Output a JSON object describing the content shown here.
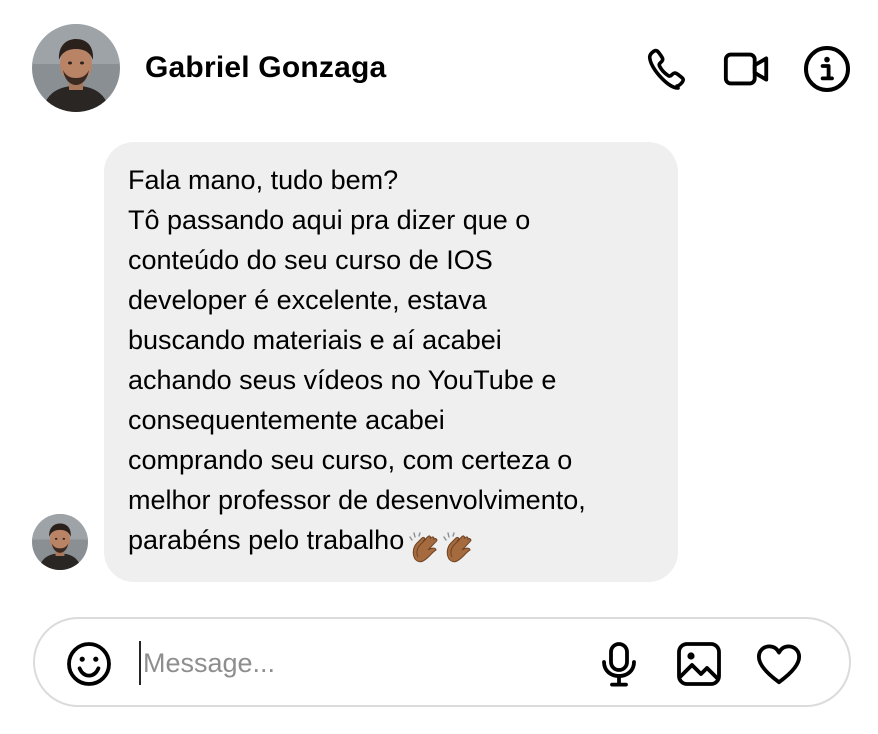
{
  "header": {
    "contact_name": "Gabriel Gonzaga",
    "avatar_icon": "profile-photo",
    "actions": [
      {
        "name": "phone-call",
        "icon": "phone-icon"
      },
      {
        "name": "video-call",
        "icon": "video-camera-icon"
      },
      {
        "name": "conversation-info",
        "icon": "info-icon"
      }
    ]
  },
  "conversation": {
    "messages": [
      {
        "sender": "Gabriel Gonzaga",
        "direction": "incoming",
        "lines": [
          "Fala mano, tudo bem?",
          "Tô passando aqui pra dizer que o",
          "conteúdo do seu curso de IOS",
          "developer é excelente, estava",
          "buscando materiais e aí acabei",
          "achando seus vídeos no YouTube e",
          "consequentemente acabei",
          "comprando seu curso, com certeza o",
          "melhor professor de desenvolvimento,",
          "parabéns pelo trabalho"
        ],
        "trailing_emoji": "clapping-hands-icon",
        "trailing_emoji_count": 2,
        "bubble_color": "#efefef"
      }
    ]
  },
  "composer": {
    "placeholder": "Message...",
    "value": "",
    "left_icon": "emoji-icon",
    "right_icons": [
      "microphone-icon",
      "image-icon",
      "heart-icon"
    ],
    "border_color": "#dbdbdb"
  }
}
